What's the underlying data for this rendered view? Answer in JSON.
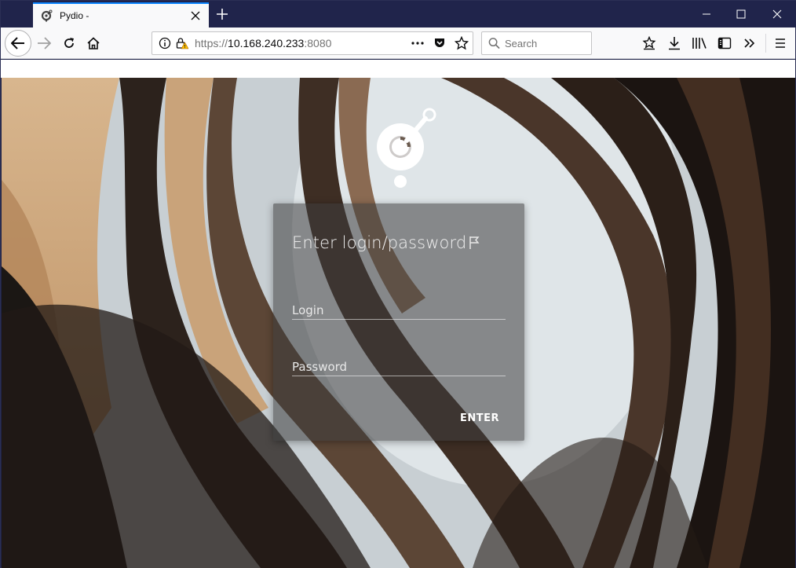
{
  "browser": {
    "tab_title": "Pydio -",
    "url": {
      "scheme": "https://",
      "host": "10.168.240.233",
      "port": ":8080"
    },
    "search_placeholder": "Search",
    "icons": {
      "back": "back-arrow-icon",
      "forward": "forward-arrow-icon",
      "reload": "reload-icon",
      "home": "home-icon",
      "info": "info-icon",
      "insecure_lock": "insecure-lock-icon",
      "page_actions": "more-dots-icon",
      "pocket": "pocket-icon",
      "bookmark_star": "bookmark-star-icon",
      "bookmarks_menu": "bookmarks-menu-icon",
      "downloads": "download-icon",
      "library": "library-icon",
      "sidebar": "sidebar-icon",
      "overflow": "overflow-chevrons-icon",
      "menu": "hamburger-menu-icon"
    }
  },
  "login": {
    "heading": "Enter login/password",
    "login_placeholder": "Login",
    "password_placeholder": "Password",
    "enter_label": "ENTER",
    "language_icon": "flag-icon"
  },
  "colors": {
    "accent": "#0a84ff",
    "titlebar": "#20244b",
    "card": "rgba(60,60,60,0.55)"
  }
}
